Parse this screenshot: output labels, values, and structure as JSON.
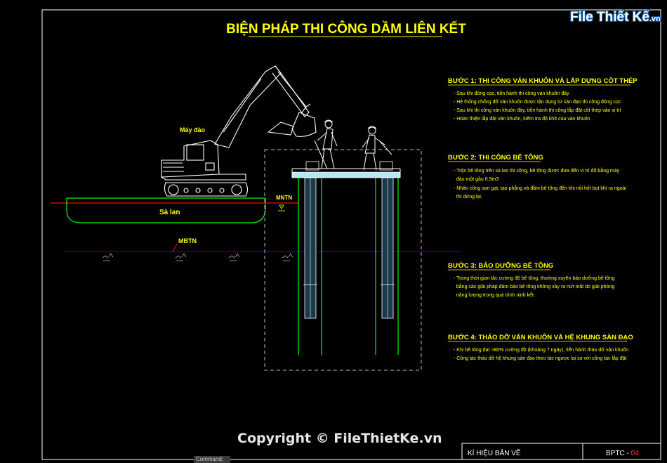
{
  "title": "BIỆN PHÁP THI CÔNG DẦM LIÊN KẾT",
  "labels": {
    "excavator": "Máy đào",
    "barge": "Sà lan",
    "mntn": "MNTN",
    "mbtn": "MBTN"
  },
  "steps": [
    {
      "heading": "BƯỚC 1: THI CÔNG VÁN KHUÔN VÀ LẮP DỰNG CỐT THÉP",
      "lines": [
        "- Sau khi đóng cọc, tiến hành thi công ván khuôn đáy",
        "- Hệ thống chống đỡ ván khuôn được tận dụng từ sàn đạo thi công đóng cọc",
        "- Sau khi thi công ván khuôn đáy, tiến hành thi công lắp đặt cốt thép vào vị trí",
        "- Hoàn thiện lắp đặt ván khuôn, kiểm tra độ khít của ván khuôn"
      ]
    },
    {
      "heading": "BƯỚC 2: THI CÔNG BÊ TÔNG",
      "lines": [
        "- Trộn bê tông trên sà lan thi công, bê tông được đưa đến vị trí đổ bằng máy",
        "  đào một gầu 0.9m3",
        "- Nhân công san gạt, tạo phẳng và đầm bê tông đến khi nổi hết bọt khí ra ngoài",
        "  thì dừng lại."
      ]
    },
    {
      "heading": "BƯỚC 3: BẢO DƯỠNG BÊ TÔNG",
      "lines": [
        "- Trong thời gian tăc cường độ bê tông, thường xuyên bảo dưỡng bê tông",
        "  bằng các giải pháp đảm bảo bê tông không xảy ra nứt mặt do giải phóng",
        "  năng lượng trong quá trình ninh kết."
      ]
    },
    {
      "heading": "BƯỚC 4: THÁO DỠ VÁN KHUÔN VÀ HỆ KHUNG SÀN ĐẠO",
      "lines": [
        "- Khi bê tông đạt >80% cường độ (khoảng 7 ngày), tiến hành tháo dỡ ván khuôn",
        "- Công tác tháo dỡ hệ khung sàn đạo theo tác ngược lại so với công tác lắp đặt"
      ]
    }
  ],
  "titleblock": {
    "label": "KÍ HIỆU BẢN VẼ",
    "code_prefix": "BPTC - ",
    "code_number": "04"
  },
  "logo": {
    "text": "File Thiết Kế",
    "suffix": ".vn"
  },
  "copyright": "Copyright © FileThietKe.vn",
  "command": "Command:",
  "colors": {
    "background": "#000000",
    "frame": "#ffffff",
    "title": "#ffff00",
    "text": "#ffff00",
    "steel": "#00ff00",
    "pile_fill": "#1a3a4a",
    "platform": "#b7e6f5",
    "water": "#0000ff",
    "mntn_line": "#ff0000",
    "mark": "#ff0000"
  }
}
